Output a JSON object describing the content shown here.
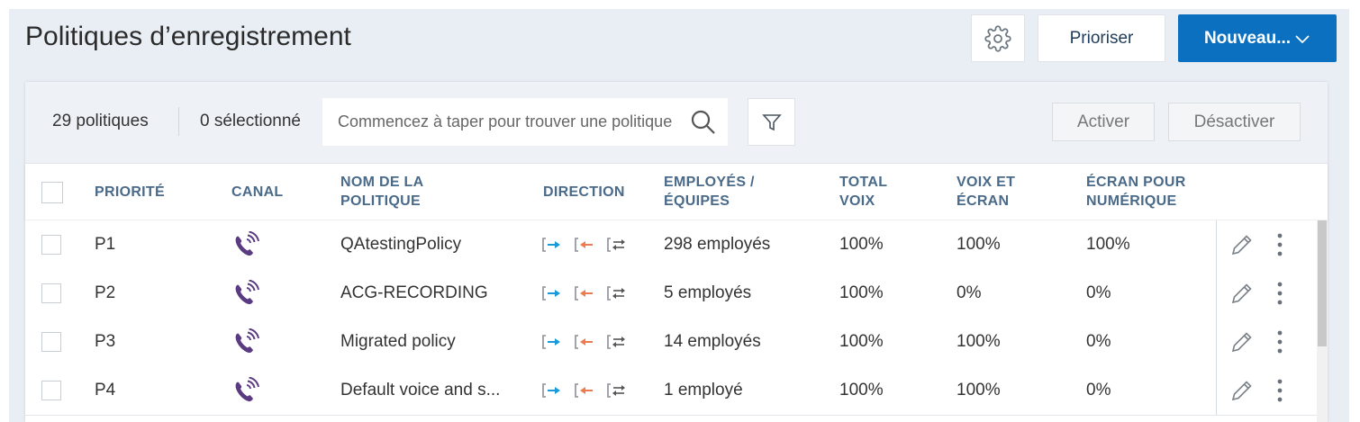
{
  "header": {
    "title": "Politiques d’enregistrement",
    "prioritize_label": "Prioriser",
    "new_label": "Nouveau..."
  },
  "toolbar": {
    "count": "29 politiques",
    "selected": "0 sélectionné",
    "search_placeholder": "Commencez à taper pour trouver une politique",
    "activate_label": "Activer",
    "deactivate_label": "Désactiver"
  },
  "table": {
    "columns": {
      "priority": "PRIORITÉ",
      "channel": "CANAL",
      "policy_name_1": "NOM DE LA",
      "policy_name_2": "POLITIQUE",
      "direction": "DIRECTION",
      "employees_1": "EMPLOYÉS /",
      "employees_2": "ÉQUIPES",
      "total_voice_1": "TOTAL",
      "total_voice_2": "VOIX",
      "voice_screen_1": "VOIX ET",
      "voice_screen_2": "ÉCRAN",
      "screen_digital_1": "ÉCRAN POUR",
      "screen_digital_2": "NUMÉRIQUE"
    },
    "rows": [
      {
        "priority": "P1",
        "name": "QAtestingPolicy",
        "employees": "298 employés",
        "total_voice": "100%",
        "voice_screen": "100%",
        "screen_digital": "100%"
      },
      {
        "priority": "P2",
        "name": "ACG-RECORDING",
        "employees": "5 employés",
        "total_voice": "100%",
        "voice_screen": "0%",
        "screen_digital": "0%"
      },
      {
        "priority": "P3",
        "name": "Migrated policy",
        "employees": "14 employés",
        "total_voice": "100%",
        "voice_screen": "100%",
        "screen_digital": "0%"
      },
      {
        "priority": "P4",
        "name": "Default voice and s...",
        "employees": "1 employé",
        "total_voice": "100%",
        "voice_screen": "100%",
        "screen_digital": "0%"
      }
    ]
  },
  "icons": {
    "channel": "phone-voice-icon",
    "inbound": "inbound-arrow-icon",
    "outbound": "outbound-arrow-icon",
    "internal": "internal-arrows-icon"
  },
  "colors": {
    "primary": "#0b70c0",
    "channel_icon": "#5a3a80",
    "inbound": "#1a9bd7",
    "outbound": "#ee7a4f"
  }
}
